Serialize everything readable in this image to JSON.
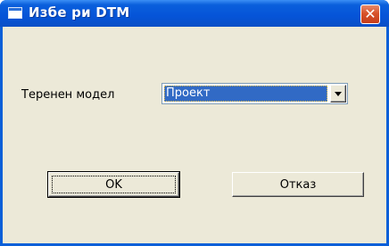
{
  "window": {
    "title": "Избе ри DTM",
    "close_glyph": "✕",
    "icons": {
      "title": "window-icon",
      "close": "close-icon"
    },
    "colors": {
      "titlebar": "#0554d8",
      "client": "#ece9d8",
      "selection": "#316ac5",
      "close": "#d8532b"
    }
  },
  "form": {
    "terrain_label": "Теренен модел",
    "terrain_select": {
      "selected": "Проект"
    }
  },
  "buttons": {
    "ok_label": "OK",
    "cancel_label": "Отказ"
  }
}
